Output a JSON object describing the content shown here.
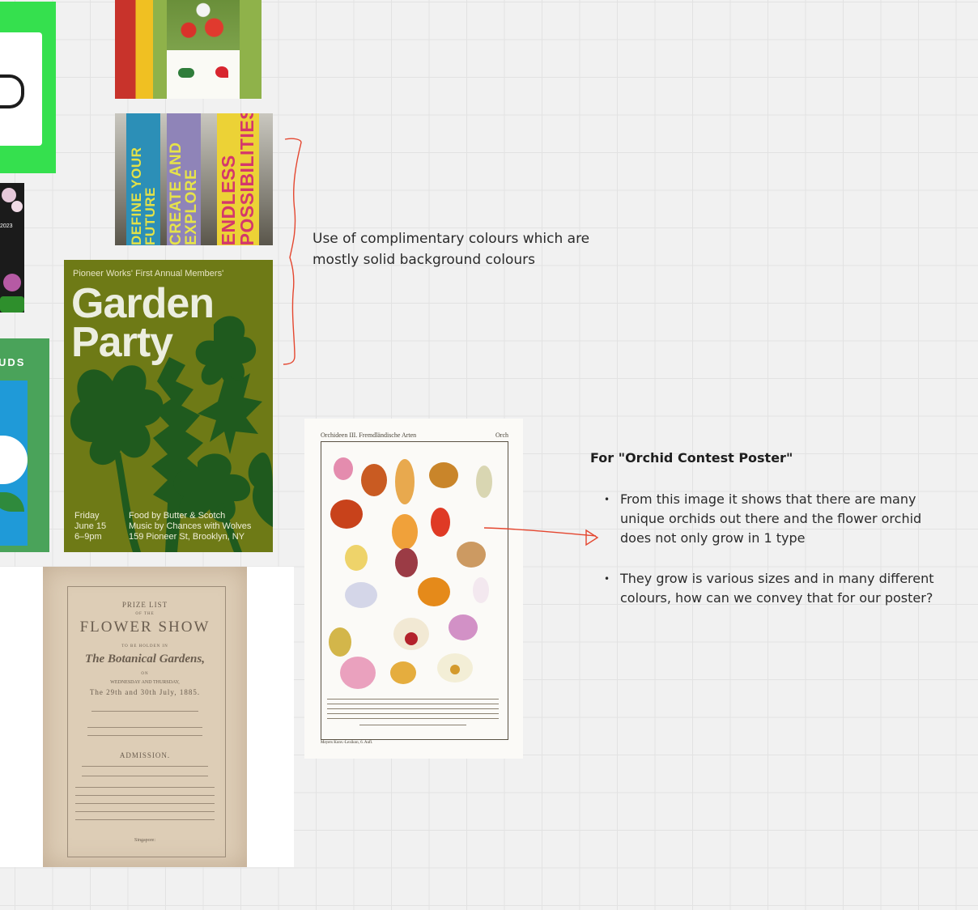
{
  "canvas": {
    "background": "#f1f1f1",
    "grid_color": "#e2e2e2"
  },
  "cards": {
    "banners": {
      "flag1": "DEFINE YOUR FUTURE",
      "flag2": "CREATE AND EXPLORE",
      "flag3": "ENDLESS POSSIBILITIES"
    },
    "dark_poster": {
      "year": "2023"
    },
    "ouds_poster": {
      "title": "UDS"
    },
    "garden_party": {
      "subtitle": "Pioneer Works' First Annual Members'",
      "line1": "Garden",
      "line2": "Party",
      "date": "Friday\nJune 15\n6–9pm",
      "info": "Food by Butter & Scotch\nMusic by Chances with Wolves\n159 Pioneer St, Brooklyn, NY",
      "bg": "#6e7a16",
      "leaf": "#1f5a1e"
    },
    "prize_list": {
      "l1": "PRIZE LIST",
      "l2": "OF THE",
      "l3": "FLOWER SHOW",
      "l4": "TO BE HOLDEN IN",
      "l5": "The Botanical Gardens,",
      "l6": "ON",
      "l7": "WEDNESDAY AND THURSDAY,",
      "l8": "The 29th and 30th July, 1885.",
      "l9": "ADMISSION.",
      "l10": "Singapore:"
    },
    "orchid_plate": {
      "title": "Orchideen III. Fremdländische Arten",
      "corner": "Orch",
      "footer": "Meyers Konv.-Lexikon, 6. Aufl."
    }
  },
  "notes": {
    "colours": "Use of complimentary colours which are mostly solid background colours",
    "orchid_title": "For \"Orchid Contest Poster\"",
    "bullets": [
      "From this image it shows that there are many unique orchids out there and the flower orchid does not only grow in 1 type",
      "They grow is various sizes and in many different colours, how can we convey that for our poster?"
    ]
  },
  "annotation_color": "#e4462f"
}
